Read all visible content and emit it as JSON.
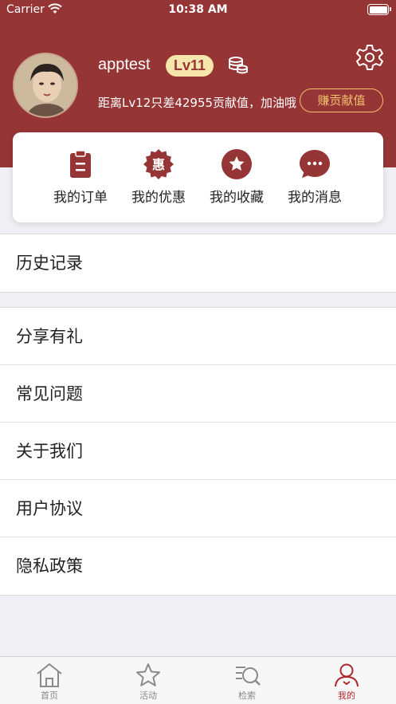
{
  "status_bar": {
    "carrier": "Carrier",
    "time": "10:38 AM"
  },
  "profile": {
    "username": "apptest",
    "level": "Lv11",
    "progress_text": "距离Lv12只差42955贡献值，加油哦",
    "earn_button": "赚贡献值"
  },
  "quick_actions": [
    {
      "label": "我的订单",
      "icon": "order-clipboard-icon"
    },
    {
      "label": "我的优惠",
      "icon": "discount-badge-icon",
      "glyph": "惠"
    },
    {
      "label": "我的收藏",
      "icon": "star-favorite-icon"
    },
    {
      "label": "我的消息",
      "icon": "message-bubble-icon"
    }
  ],
  "menu_group_1": [
    "历史记录"
  ],
  "menu_group_2": [
    "分享有礼",
    "常见问题",
    "关于我们",
    "用户协议",
    "隐私政策"
  ],
  "tabbar": {
    "tabs": [
      {
        "label": "首页",
        "icon": "home-icon"
      },
      {
        "label": "活动",
        "icon": "star-icon"
      },
      {
        "label": "检索",
        "icon": "search-list-icon"
      },
      {
        "label": "我的",
        "icon": "user-icon"
      }
    ],
    "active_index": 3
  },
  "colors": {
    "header": "#963536",
    "accent_gold": "#f2c16b",
    "badge_bg": "#f7e6ab",
    "active_tab": "#b0262a"
  }
}
